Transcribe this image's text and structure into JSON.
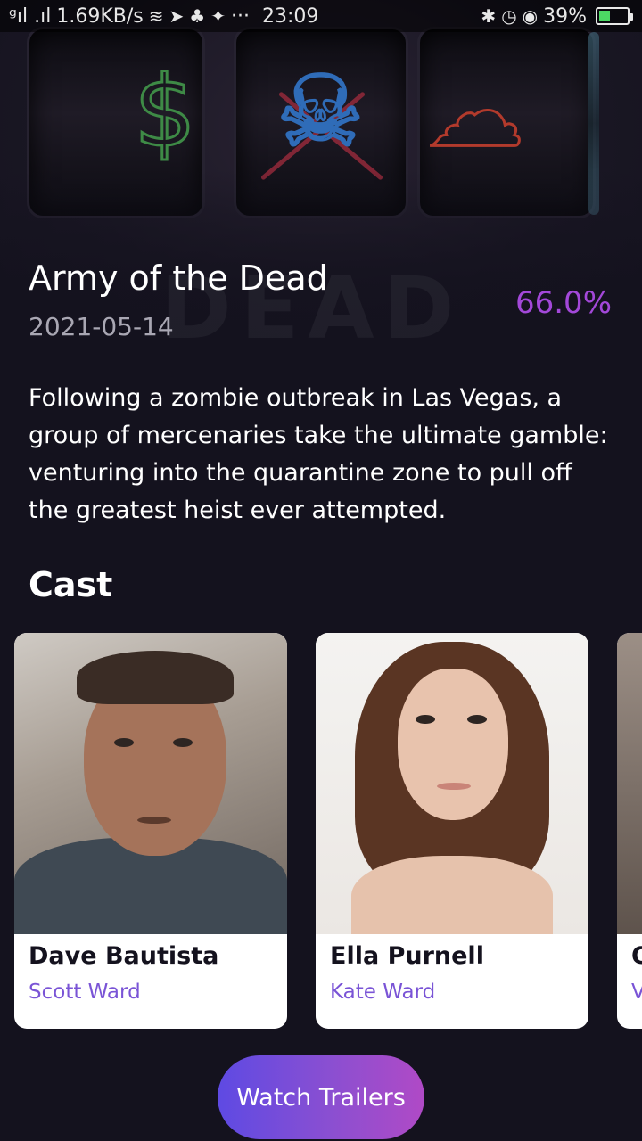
{
  "status_bar": {
    "signal_text": "ᵍıl .ıl",
    "network_speed": "1.69KB/s",
    "more_indicator": "···",
    "time": "23:09",
    "battery_percent": "39%",
    "battery_level": 0.39,
    "icons": [
      "signal-icon",
      "wifi-icon",
      "telegram-icon",
      "app-icon",
      "twitter-icon",
      "bluetooth-icon",
      "alarm-icon",
      "eye-icon",
      "battery-icon"
    ]
  },
  "movie": {
    "title": "Army of the Dead",
    "release_date": "2021-05-14",
    "rating": "66.0%",
    "overview": "Following a zombie outbreak in Las Vegas, a group of mercenaries take the ultimate gamble: venturing into the quarantine zone to pull off the greatest heist ever attempted."
  },
  "cast_section": {
    "heading": "Cast",
    "members": [
      {
        "name": "Dave Bautista",
        "character": "Scott Ward"
      },
      {
        "name": "Ella Purnell",
        "character": "Kate Ward"
      },
      {
        "name": "O",
        "character": "V"
      }
    ]
  },
  "actions": {
    "watch_trailers_label": "Watch Trailers"
  },
  "colors": {
    "background": "#14121e",
    "rating": "#a348d9",
    "character_name": "#7a54d6",
    "button_gradient_start": "#5e4ae3",
    "button_gradient_end": "#b04ac6"
  }
}
